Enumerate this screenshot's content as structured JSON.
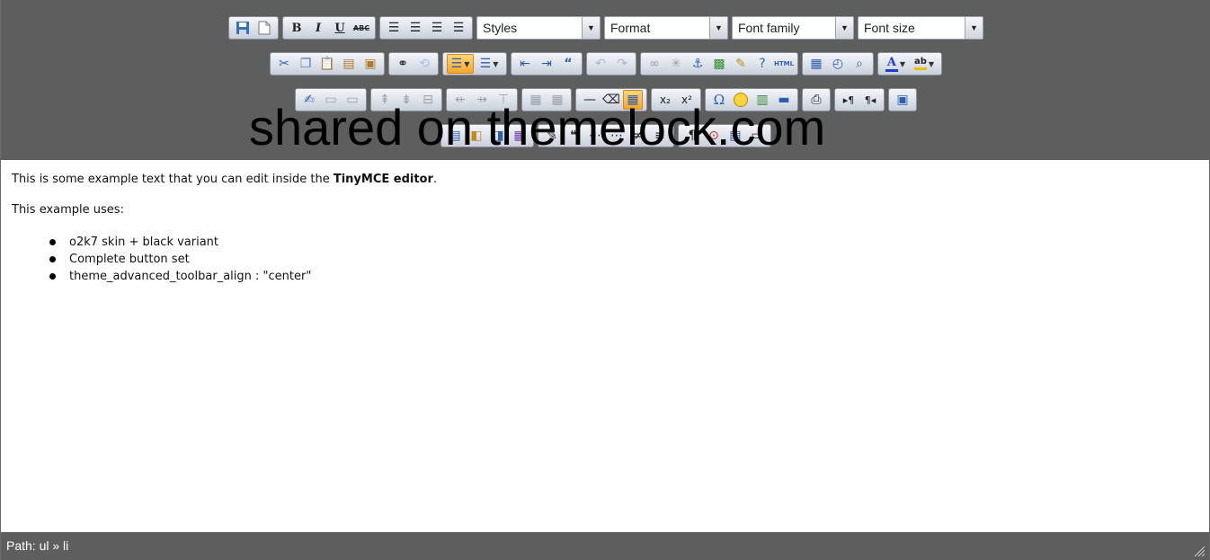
{
  "toolbar": {
    "styles_select": "Styles",
    "format_select": "Format",
    "font_family_select": "Font family",
    "font_size_select": "Font size",
    "bold_label": "B",
    "italic_label": "I",
    "underline_label": "U",
    "strike_label": "ABC",
    "html_label": "HTML",
    "text_color_label": "A",
    "highlight_label": "ab",
    "omega_label": "Ω",
    "subscript_label": "x₂",
    "superscript_label": "x²"
  },
  "content": {
    "line1_prefix": "This is some example text that you can edit inside the ",
    "line1_bold": "TinyMCE editor",
    "line1_suffix": ".",
    "line2": "This example uses:",
    "list_items": [
      "o2k7 skin + black variant",
      "Complete button set",
      "theme_advanced_toolbar_align : \"center\""
    ]
  },
  "statusbar": {
    "path_label": "Path: ul » li"
  },
  "watermark": "shared on themelock.com",
  "colors": {
    "toolbar_bg": "#5e5e5e",
    "active_button": "#f4a62a",
    "text_color": "#1a3fd0",
    "highlight_color": "#e8c400"
  }
}
